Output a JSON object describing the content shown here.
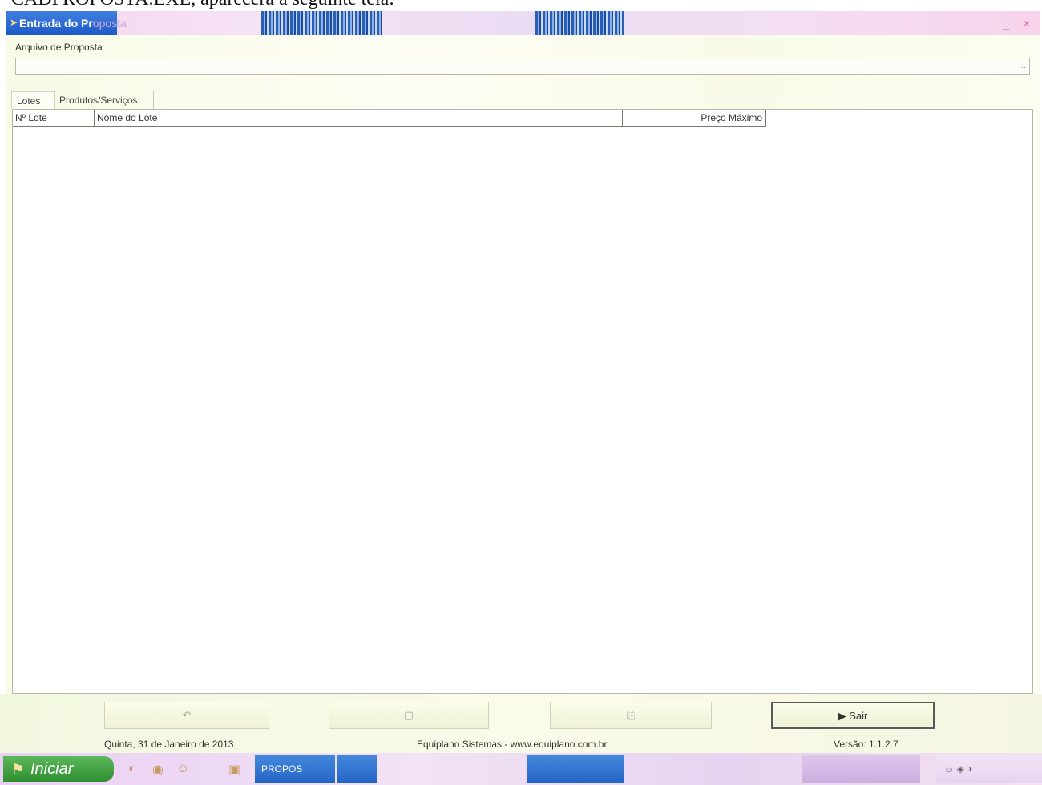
{
  "document": {
    "caption": "CADPROPOSTA.EXE, aparecerá a seguinte tela:"
  },
  "window": {
    "title": "Entrada de Proposta",
    "title_visible": "Entrada do Pr",
    "title_faded": "oposta",
    "minimize_glyph": "_",
    "close_glyph": "×"
  },
  "form": {
    "file_label": "Arquivo de Proposta",
    "file_value": "",
    "file_dots": "..."
  },
  "tabs": [
    {
      "label": "Lotes",
      "active": true
    },
    {
      "label": "Produtos/Serviços",
      "active": false
    }
  ],
  "grid": {
    "columns": [
      "Nº Lote",
      "Nome do Lote",
      "Preço Máximo"
    ],
    "rows": []
  },
  "buttons": [
    {
      "label": "",
      "icon": "new-icon",
      "glyph": "↶"
    },
    {
      "label": "",
      "icon": "save-icon",
      "glyph": "▢"
    },
    {
      "label": "",
      "icon": "open-icon",
      "glyph": "⎘"
    },
    {
      "label": "Sair",
      "icon": "exit-icon",
      "glyph": "▶"
    }
  ],
  "status_bar": {
    "date": "Quinta, 31 de Janeiro de 2013",
    "company": "Equiplano Sistemas - www.equiplano.com.br",
    "version": "Versão: 1.1.2.7"
  },
  "taskbar": {
    "start_label": "Iniciar",
    "start_glyph": "⚑",
    "quicklaunch_glyphs": [
      "◐",
      "◉",
      "☺",
      "▣"
    ],
    "task_label": "PROPOS",
    "tray_glyphs": "☺ ◈ ◑"
  },
  "colors": {
    "title_active": "#1e59c8",
    "window_bg": "#fafbe8",
    "taskbar_bg": "#e8d0f2",
    "start_green": "#2f8e2f"
  }
}
